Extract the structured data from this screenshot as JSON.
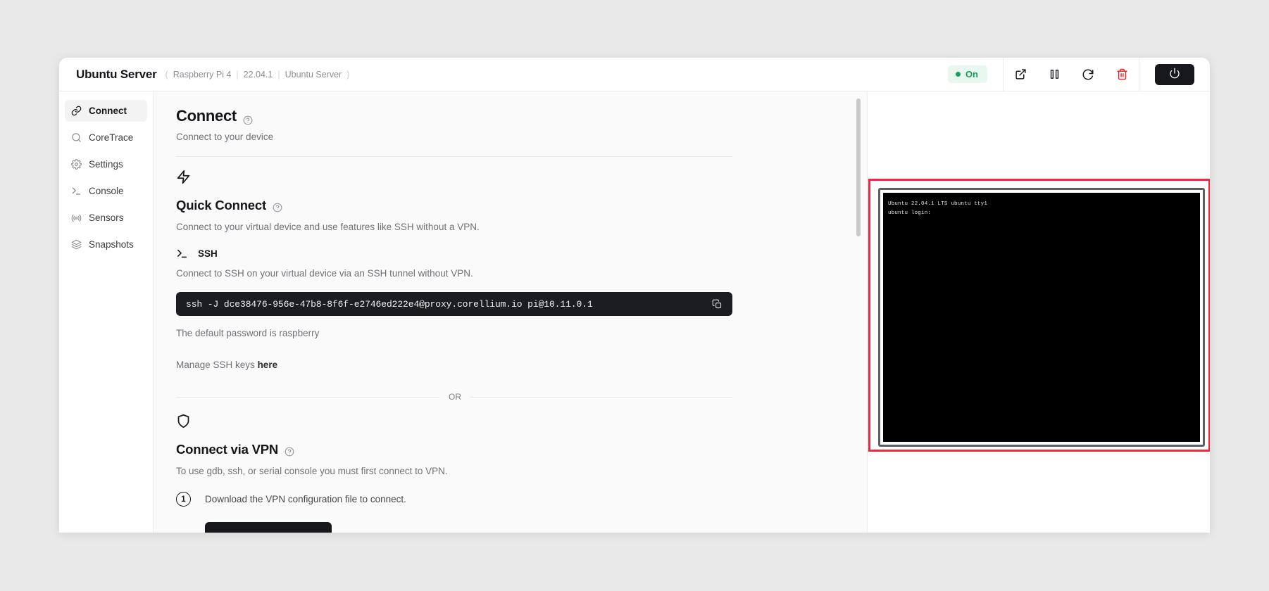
{
  "window": {
    "title": "Ubuntu Server",
    "meta": {
      "open_paren": "(",
      "device": "Raspberry Pi 4",
      "version": "22.04.1",
      "name": "Ubuntu Server",
      "close_paren": ")",
      "separator": "|"
    },
    "status": {
      "label": "On",
      "color": "#17a05a",
      "background": "#e9f8ef"
    },
    "toolbar": [
      {
        "name": "open-external-button",
        "icon": "external-link-icon",
        "color": "#16181c"
      },
      {
        "name": "pause-button",
        "icon": "pause-icon",
        "color": "#16181c"
      },
      {
        "name": "restart-button",
        "icon": "refresh-icon",
        "color": "#16181c"
      },
      {
        "name": "delete-button",
        "icon": "trash-icon",
        "color": "#f02020"
      }
    ],
    "power_button": {
      "label": "",
      "icon": "power-icon",
      "background": "#16181c"
    }
  },
  "sidebar": {
    "items": [
      {
        "label": "Connect",
        "icon": "link-icon",
        "active": true
      },
      {
        "label": "CoreTrace",
        "icon": "search-icon",
        "active": false
      },
      {
        "label": "Settings",
        "icon": "gear-icon",
        "active": false
      },
      {
        "label": "Console",
        "icon": "terminal-icon",
        "active": false
      },
      {
        "label": "Sensors",
        "icon": "signal-icon",
        "active": false
      },
      {
        "label": "Snapshots",
        "icon": "layers-icon",
        "active": false
      }
    ]
  },
  "main": {
    "title": "Connect",
    "subtitle": "Connect to your device",
    "quick_connect": {
      "heading": "Quick Connect",
      "description": "Connect to your virtual device and use features like SSH without a VPN.",
      "ssh_label": "SSH",
      "ssh_description": "Connect to SSH on your virtual device via an SSH tunnel without VPN.",
      "command": "ssh -J dce38476-956e-47b8-8f6f-e2746ed222e4@proxy.corellium.io pi@10.11.0.1",
      "password_note": "The default password is raspberry",
      "manage_prefix": "Manage SSH keys ",
      "manage_link": "here"
    },
    "divider_label": "OR",
    "vpn": {
      "heading": "Connect via VPN",
      "description": "To use gdb, ssh, or serial console you must first connect to VPN.",
      "step_number": "1",
      "step_text": "Download the VPN configuration file to connect."
    }
  },
  "device": {
    "terminal_lines": [
      "Ubuntu 22.04.1 LTS ubuntu tty1",
      "",
      "ubuntu login:"
    ],
    "highlight_color": "#f8253c"
  }
}
